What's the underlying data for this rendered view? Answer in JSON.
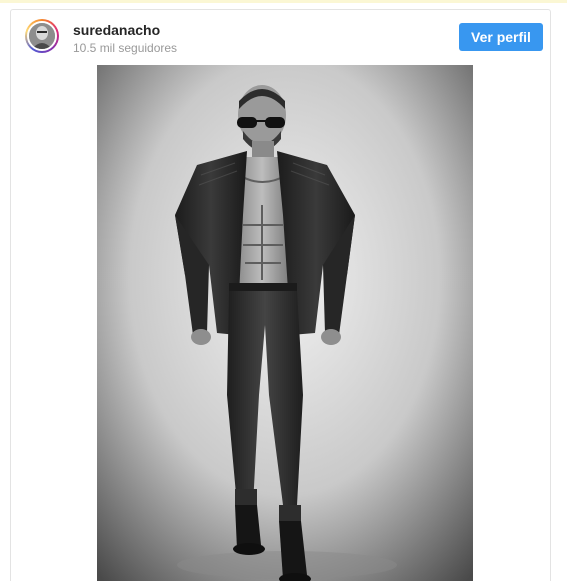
{
  "profile": {
    "username": "suredanacho",
    "followers": "10.5 mil seguidores",
    "view_profile_label": "Ver perfil"
  },
  "icons": {
    "avatar": "profile-photo",
    "photo": "post-photo"
  },
  "colors": {
    "accent": "#3897f0",
    "username": "#262626",
    "secondary_text": "#999999",
    "photo_bg_light": "#e9e9e9",
    "photo_bg_dark": "#3a3a3a"
  }
}
